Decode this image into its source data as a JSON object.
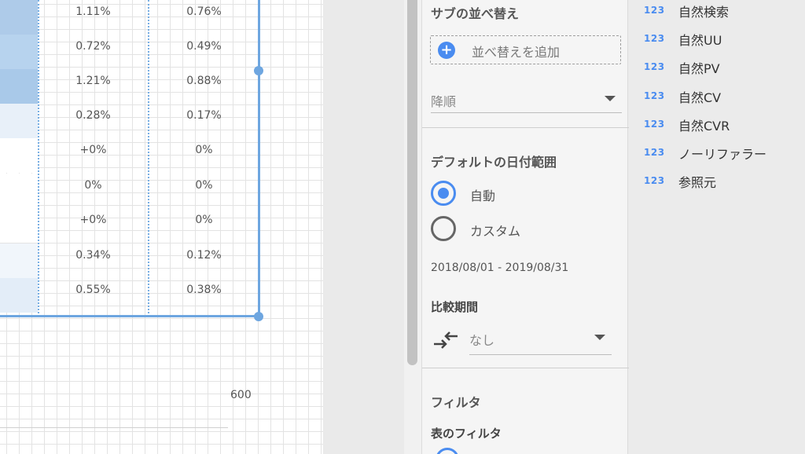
{
  "table": {
    "rows": [
      {
        "col1": "1.11%",
        "col2": "0.76%",
        "heat_color": "#aecbe9"
      },
      {
        "col1": "0.72%",
        "col2": "0.49%",
        "heat_color": "#b7d3ee"
      },
      {
        "col1": "1.21%",
        "col2": "0.88%",
        "heat_color": "#a9c9e9"
      },
      {
        "col1": "0.28%",
        "col2": "0.17%",
        "heat_color": "#e8f0f9"
      },
      {
        "col1": "+0%",
        "col2": "0%",
        "heat_color": "#ffffff"
      },
      {
        "col1": "0%",
        "col2": "0%",
        "heat_color": "#ffffff"
      },
      {
        "col1": "+0%",
        "col2": "0%",
        "heat_color": "#ffffff"
      },
      {
        "col1": "0.34%",
        "col2": "0.12%",
        "heat_color": "#f1f6fb"
      },
      {
        "col1": "0.55%",
        "col2": "0.38%",
        "heat_color": "#e3edf8"
      }
    ]
  },
  "chart": {
    "axis_tick": "600"
  },
  "panel": {
    "sub_sort_title": "サブの並べ替え",
    "add_sort_label": "並べ替えを追加",
    "sort_order": "降順",
    "date_range_title": "デフォルトの日付範囲",
    "radio_auto": "自動",
    "radio_custom": "カスタム",
    "date_range": "2018/08/01 - 2019/08/31",
    "compare_title": "比較期間",
    "compare_value": "なし",
    "filter_title": "フィルタ",
    "table_filter_title": "表のフィルタ"
  },
  "fields": [
    {
      "icon": "123",
      "label": "自然検索"
    },
    {
      "icon": "123",
      "label": "自然UU"
    },
    {
      "icon": "123",
      "label": "自然PV"
    },
    {
      "icon": "123",
      "label": "自然CV"
    },
    {
      "icon": "123",
      "label": "自然CVR"
    },
    {
      "icon": "123",
      "label": "ノーリファラー"
    },
    {
      "icon": "123",
      "label": "参照元"
    }
  ],
  "colors": {
    "accent": "#4a8cf0",
    "selection": "#6ea6e0"
  }
}
